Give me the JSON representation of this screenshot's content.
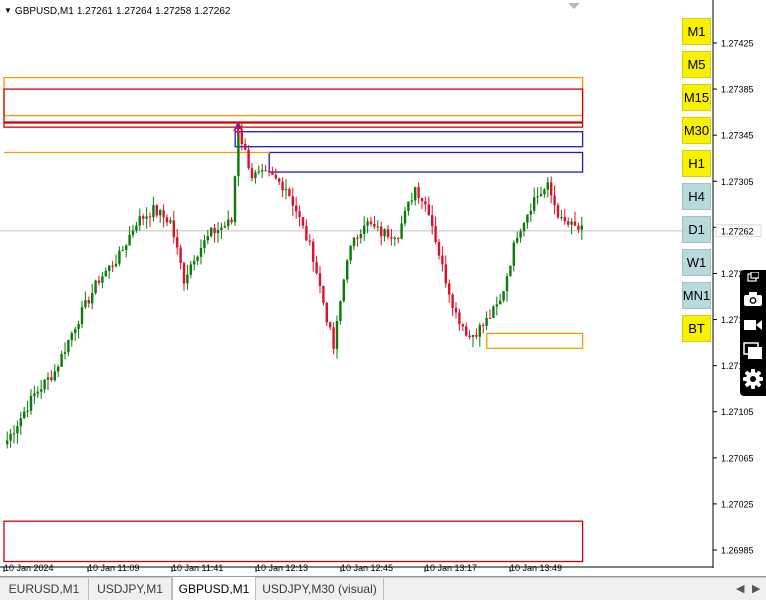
{
  "header": {
    "symbol": "GBPUSD,M1",
    "open": "1.27261",
    "high": "1.27264",
    "low": "1.27258",
    "close": "1.27262"
  },
  "timeframes": [
    {
      "label": "M1",
      "color": "yellow"
    },
    {
      "label": "M5",
      "color": "yellow"
    },
    {
      "label": "M15",
      "color": "yellow"
    },
    {
      "label": "M30",
      "color": "yellow"
    },
    {
      "label": "H1",
      "color": "yellow"
    },
    {
      "label": "H4",
      "color": "blue"
    },
    {
      "label": "D1",
      "color": "blue"
    },
    {
      "label": "W1",
      "color": "blue"
    },
    {
      "label": "MN1",
      "color": "blue"
    },
    {
      "label": "BT",
      "color": "yellow"
    }
  ],
  "tools": [
    "screenshot-icon",
    "camera-icon",
    "video-icon",
    "windows-icon",
    "gear-icon"
  ],
  "tabs": [
    {
      "label": "EURUSD,M1",
      "active": false
    },
    {
      "label": "USDJPY,M1",
      "active": false
    },
    {
      "label": "GBPUSD,M1",
      "active": true
    },
    {
      "label": "USDJPY,M30 (visual)",
      "active": false
    }
  ],
  "chart_data": {
    "type": "candlestick",
    "price_ticks": [
      "1.27425",
      "1.27385",
      "1.27345",
      "1.27305",
      "1.27265",
      "1.27225",
      "1.27185",
      "1.27145",
      "1.27105",
      "1.27065",
      "1.27025",
      "1.26985"
    ],
    "price_tick_values": [
      1.27425,
      1.27385,
      1.27345,
      1.27305,
      1.27265,
      1.27225,
      1.27185,
      1.27145,
      1.27105,
      1.27065,
      1.27025,
      1.26985
    ],
    "current_price": "1.27262",
    "time_ticks": [
      "10 Jan 2024",
      "10 Jan 11:09",
      "10 Jan 11:41",
      "10 Jan 12:13",
      "10 Jan 12:45",
      "10 Jan 13:17",
      "10 Jan 13:49"
    ],
    "ylim": [
      1.26962,
      1.27447
    ],
    "bar_count": 170,
    "anchors": [
      [
        0,
        1.2708
      ],
      [
        8,
        1.2712
      ],
      [
        14,
        1.2714
      ],
      [
        20,
        1.2718
      ],
      [
        27,
        1.2722
      ],
      [
        33,
        1.2724
      ],
      [
        38,
        1.2727
      ],
      [
        43,
        1.2728
      ],
      [
        48,
        1.2727
      ],
      [
        52,
        1.2722
      ],
      [
        55,
        1.2724
      ],
      [
        60,
        1.2726
      ],
      [
        66,
        1.2727
      ],
      [
        68,
        1.2735
      ],
      [
        72,
        1.2731
      ],
      [
        77,
        1.2731
      ],
      [
        82,
        1.273
      ],
      [
        85,
        1.2728
      ],
      [
        90,
        1.2724
      ],
      [
        96,
        1.2716
      ],
      [
        100,
        1.2724
      ],
      [
        105,
        1.2727
      ],
      [
        110,
        1.2726
      ],
      [
        115,
        1.2726
      ],
      [
        120,
        1.273
      ],
      [
        124,
        1.2728
      ],
      [
        128,
        1.2723
      ],
      [
        132,
        1.2719
      ],
      [
        136,
        1.2717
      ],
      [
        140,
        1.2718
      ],
      [
        145,
        1.272
      ],
      [
        150,
        1.2726
      ],
      [
        155,
        1.2729
      ],
      [
        159,
        1.273
      ],
      [
        163,
        1.2727
      ],
      [
        169,
        1.27262
      ]
    ],
    "zones": [
      {
        "type": "rect",
        "from_bar": 0,
        "to_bar": 169,
        "y1": 1.27395,
        "y2": 1.27362,
        "color": "#ff9900"
      },
      {
        "type": "rect",
        "from_bar": 0,
        "to_bar": 169,
        "y1": 1.27385,
        "y2": 1.27352,
        "color": "#d40000"
      },
      {
        "type": "rect",
        "from_bar": 68,
        "to_bar": 169,
        "y1": 1.27348,
        "y2": 1.27335,
        "color": "#1a1ad0"
      },
      {
        "type": "rect",
        "from_bar": 78,
        "to_bar": 169,
        "y1": 1.2733,
        "y2": 1.27313,
        "color": "#1a1ad0"
      },
      {
        "type": "rect",
        "from_bar": 142,
        "to_bar": 169,
        "y1": 1.27173,
        "y2": 1.2716,
        "color": "#ff9900"
      },
      {
        "type": "rect",
        "from_bar": 0,
        "to_bar": 169,
        "y1": 1.2701,
        "y2": 1.26975,
        "color": "#d40000"
      }
    ],
    "hlines": [
      {
        "from_bar": 0,
        "to_bar": 169,
        "y": 1.27356,
        "color": "#d40000"
      },
      {
        "from_bar": 0,
        "to_bar": 77,
        "y": 1.2733,
        "color": "#ff9900"
      }
    ],
    "marker_bar": 68
  }
}
